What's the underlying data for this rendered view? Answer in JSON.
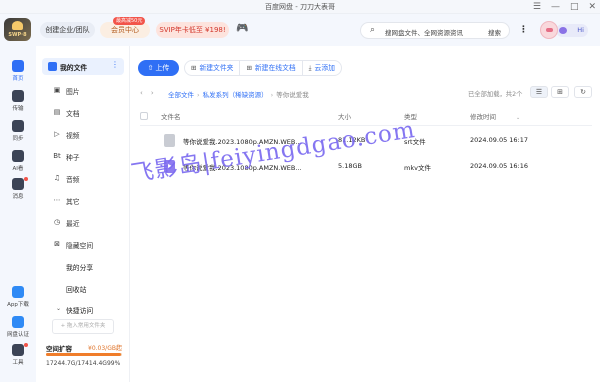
{
  "window": {
    "title": "百度网盘 - 刀刀大表哥",
    "controls": [
      "☰",
      "—",
      "□",
      "✕"
    ]
  },
  "header": {
    "logo_text": "SWP·8",
    "enterprise_label": "创建企业/团队",
    "member_label": "会员中心",
    "member_badge": "最高减50元",
    "svip_label": "SVIP年卡低至 ¥198!",
    "search_placeholder": "搜网盘文件、全网资源资讯",
    "search_button": "搜索",
    "hi_label": "Hi"
  },
  "rail": {
    "items": [
      {
        "label": "首页",
        "icon": "home-icon",
        "active": true
      },
      {
        "label": "传输",
        "icon": "transfer-icon",
        "active": false
      },
      {
        "label": "同步",
        "icon": "sync-icon",
        "active": false
      },
      {
        "label": "AI看",
        "icon": "ai-icon",
        "active": false
      },
      {
        "label": "消息",
        "icon": "message-icon",
        "active": false
      }
    ],
    "bottom": [
      {
        "label": "App下载",
        "icon": "app-download-icon"
      },
      {
        "label": "网盘认证",
        "icon": "verify-icon"
      },
      {
        "label": "工具",
        "icon": "tools-icon"
      }
    ]
  },
  "sidebar": {
    "my_files": "我的文件",
    "categories": [
      {
        "label": "图片",
        "icon": "▣"
      },
      {
        "label": "文档",
        "icon": "▤"
      },
      {
        "label": "视频",
        "icon": "▷"
      },
      {
        "label": "种子",
        "icon": "Bt"
      },
      {
        "label": "音频",
        "icon": "♫"
      },
      {
        "label": "其它",
        "icon": "⋯"
      },
      {
        "label": "最近",
        "icon": "◷"
      },
      {
        "label": "隐藏空间",
        "icon": "⊠"
      }
    ],
    "my_share": "我的分享",
    "recycle": "回收站",
    "quick_access": "快捷访问",
    "add_quick": "+ 拖入常用文件夹",
    "storage": {
      "label": "空间扩容",
      "price": "¥0.03/GB起",
      "arrow": "›",
      "usage": "17244.7G/17414.4G",
      "percent": "99%",
      "fill_fraction": 0.99
    }
  },
  "toolbar": {
    "upload": "上传",
    "new_folder": "新建文件夹",
    "new_doc": "新建在线文档",
    "cloud_add": "云添加"
  },
  "breadcrumb": {
    "root": "全部文件",
    "folder": "私发系列（稀缺资源）",
    "current": "等你说爱我"
  },
  "list_status": "已全部加载，共2个",
  "table": {
    "headers": {
      "name": "文件名",
      "size": "大小",
      "type": "类型",
      "time": "修改时间"
    },
    "rows": [
      {
        "name": "等你说爱我.2023.1080p.AMZN.WEB...",
        "size": "81.12KB",
        "type": "srt文件",
        "time": "2024.09.05 16:17",
        "kind": "doc"
      },
      {
        "name": "等你说爱我.2023.1080p.AMZN.WEB...",
        "size": "5.18GB",
        "type": "mkv文件",
        "time": "2024.09.05 16:16",
        "kind": "video"
      }
    ]
  },
  "watermark": "飞影岛|feiyingdgao.com",
  "colors": {
    "accent": "#2f6ff5",
    "storage": "#f07d2a",
    "watermark": "#7b6bf0"
  }
}
